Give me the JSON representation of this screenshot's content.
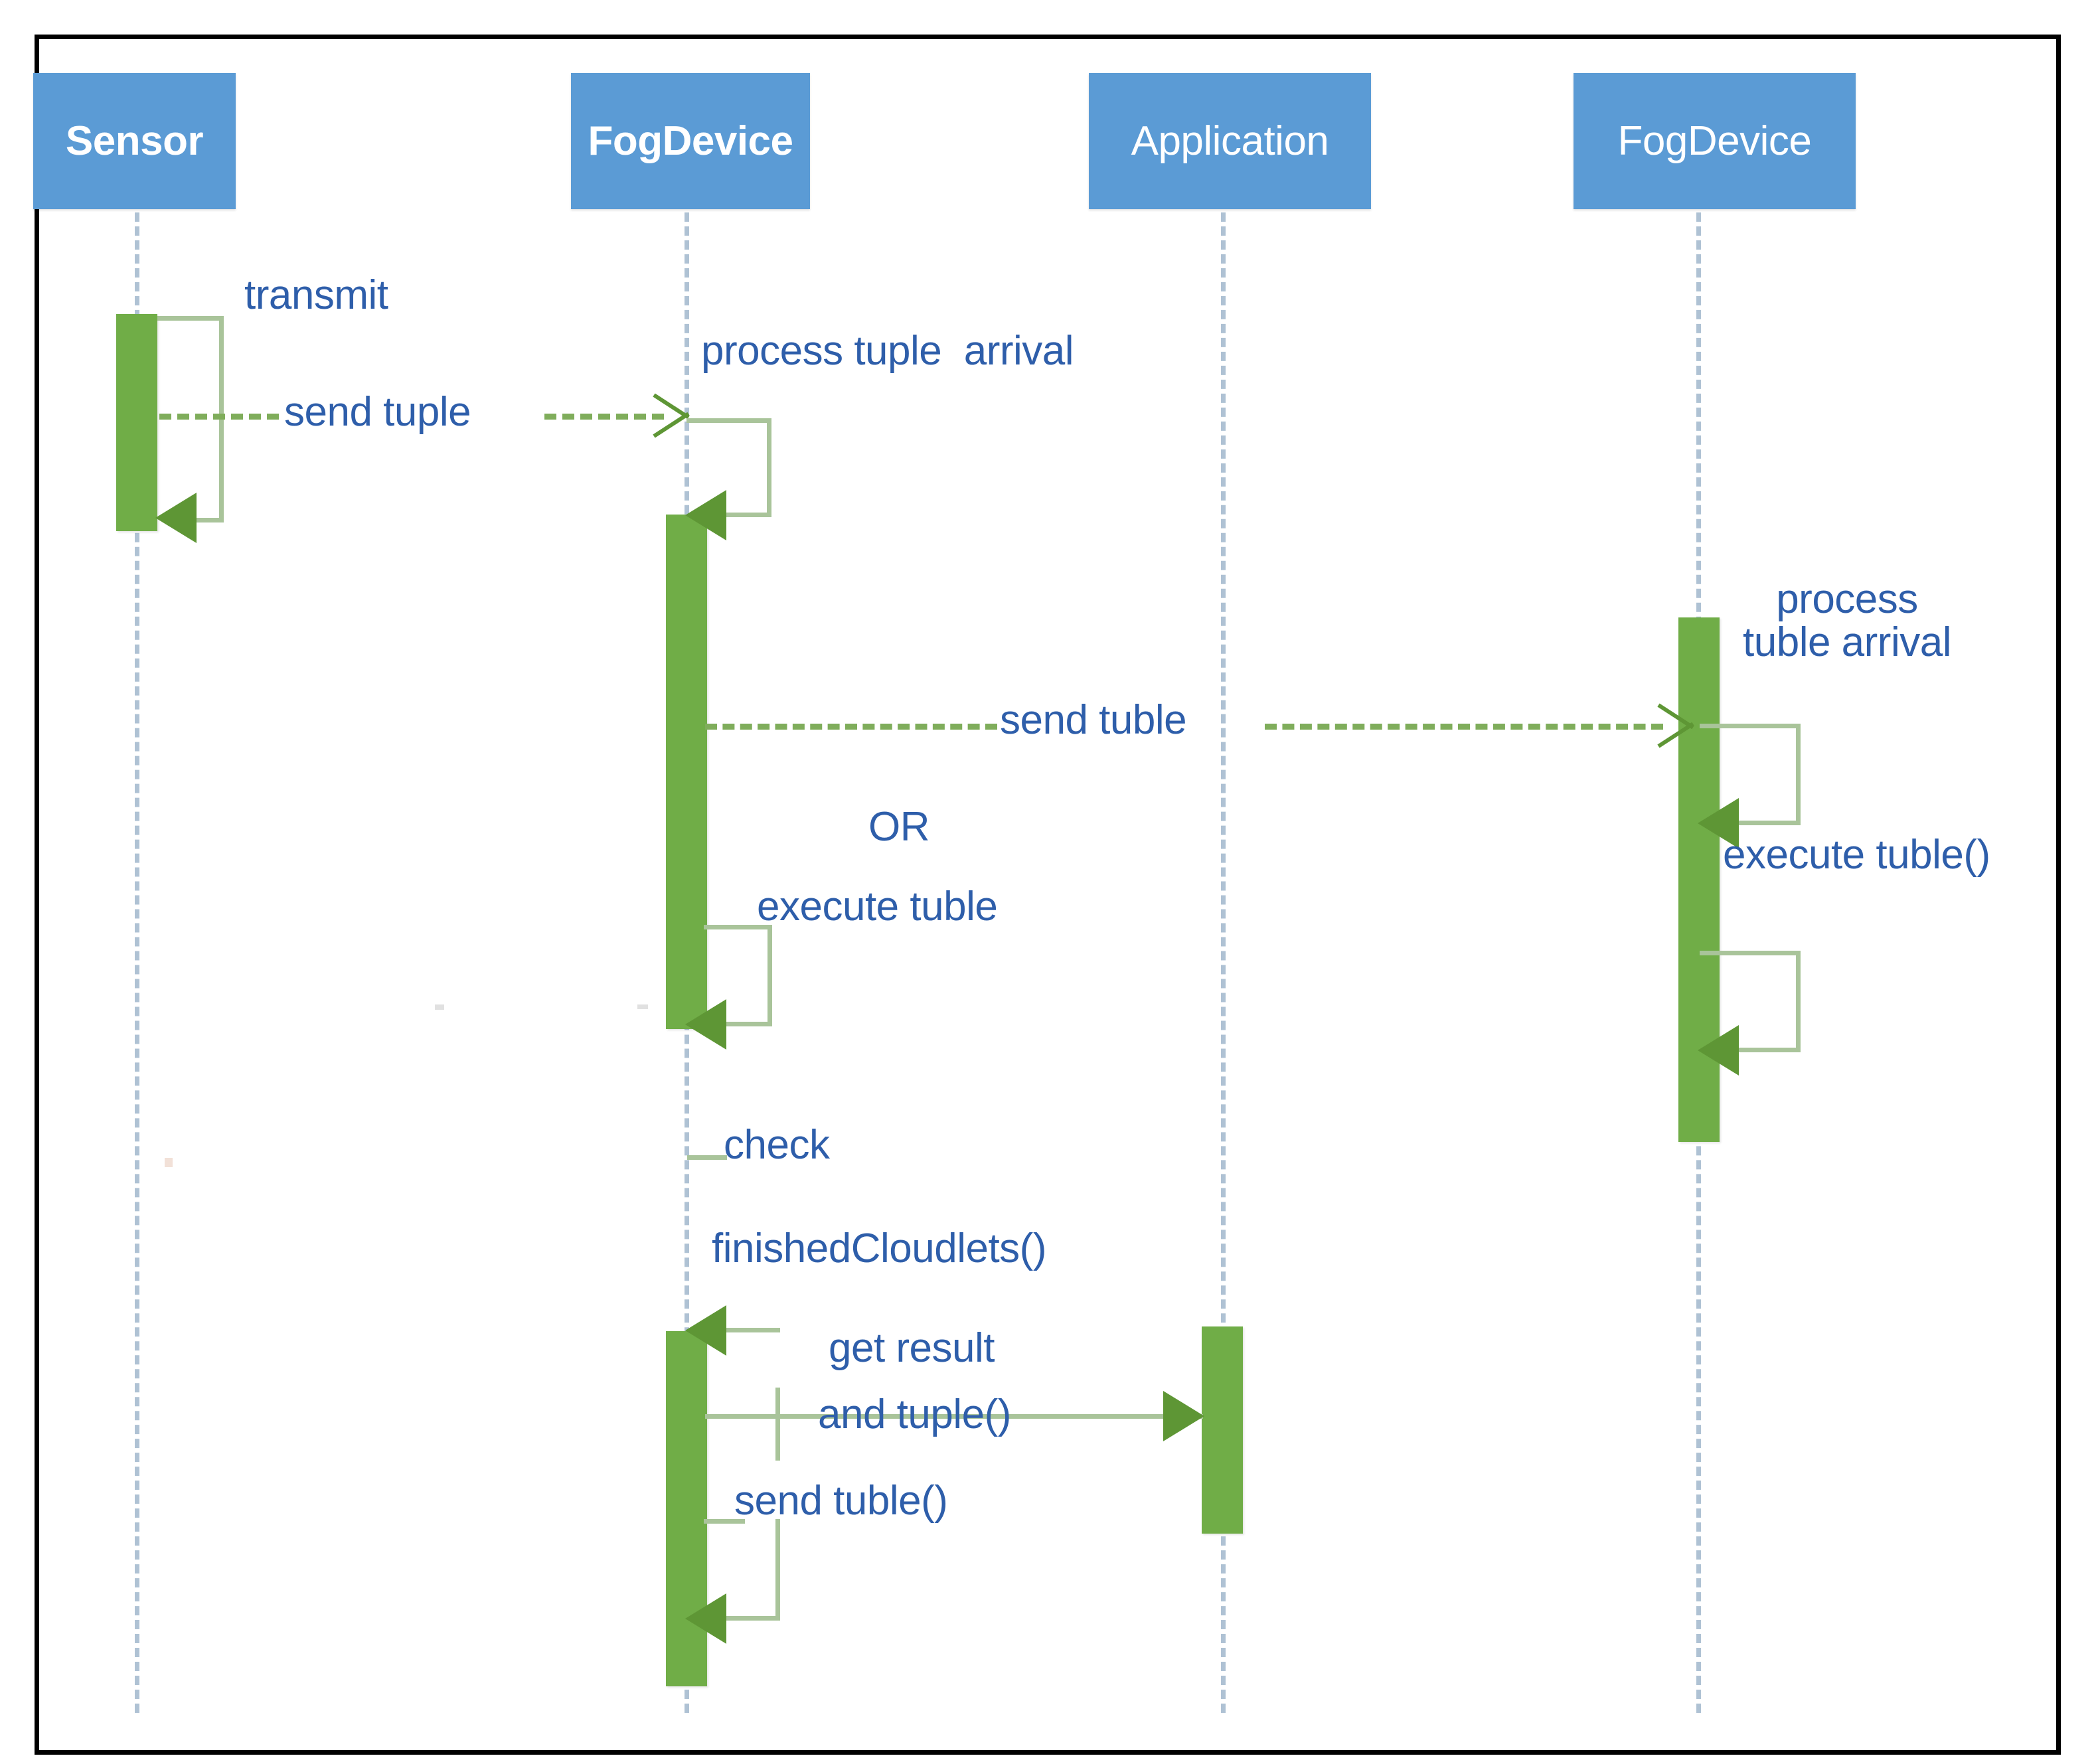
{
  "diagram": {
    "title": "Fog computing tuple processing sequence diagram",
    "type": "uml-sequence-diagram",
    "colors": {
      "lifeline_header_fill": "#5B9BD5",
      "lifeline_header_text": "#FFFFFF",
      "activation_fill": "#70AD47",
      "message_line": "#A9C49A",
      "message_dashed": "#7FAD5B",
      "arrow_head": "#5E9635",
      "label_text": "#2E5EAA",
      "lifeline_dash": "#AFC2D4",
      "frame_border": "#000000",
      "background": "#FFFFFF"
    }
  },
  "lifelines": [
    {
      "id": "sensor",
      "label": "Sensor",
      "bold": true
    },
    {
      "id": "fogdevice1",
      "label": "FogDevice",
      "bold": true
    },
    {
      "id": "application",
      "label": "Application",
      "bold": false
    },
    {
      "id": "fogdevice2",
      "label": "FogDevice",
      "bold": false
    }
  ],
  "messages": [
    {
      "id": "m1",
      "label": "transmit",
      "from": "sensor",
      "to": "sensor",
      "kind": "self",
      "style": "solid"
    },
    {
      "id": "m2",
      "label": "send tuple",
      "from": "sensor",
      "to": "fogdevice1",
      "kind": "call",
      "style": "dashed"
    },
    {
      "id": "m3",
      "label": "process tuple  arrival",
      "from": "fogdevice1",
      "to": "fogdevice1",
      "kind": "self",
      "style": "solid"
    },
    {
      "id": "m4",
      "label": "send tuble",
      "from": "fogdevice1",
      "to": "fogdevice2",
      "kind": "call",
      "style": "dashed"
    },
    {
      "id": "m5",
      "label": "process\ntuble arrival",
      "from": "fogdevice2",
      "to": "fogdevice2",
      "kind": "self",
      "style": "solid"
    },
    {
      "id": "m6",
      "label": "execute tuble()",
      "from": "fogdevice2",
      "to": "fogdevice2",
      "kind": "self",
      "style": "solid"
    },
    {
      "id": "m7",
      "label": "OR",
      "from": "fogdevice1",
      "to": "fogdevice1",
      "kind": "note",
      "style": "none"
    },
    {
      "id": "m8",
      "label": "execute tuble",
      "from": "fogdevice1",
      "to": "fogdevice1",
      "kind": "self",
      "style": "solid"
    },
    {
      "id": "m9",
      "label": "check\nfinishedCloudlets()",
      "from": "fogdevice1",
      "to": "fogdevice1",
      "kind": "self",
      "style": "solid"
    },
    {
      "id": "m10",
      "label": "get result\nand tuple()",
      "from": "fogdevice1",
      "to": "application",
      "kind": "call",
      "style": "solid"
    },
    {
      "id": "m11",
      "label": "send tuble()",
      "from": "fogdevice1",
      "to": "fogdevice1",
      "kind": "self",
      "style": "solid"
    }
  ],
  "labels": {
    "transmit": "transmit",
    "send_tuple": "send tuple",
    "process_tuple_arrival": "process tuple  arrival",
    "send_tuble": "send tuble",
    "process_line1": "process",
    "process_line2": "tuble arrival",
    "execute_tuble_paren": "execute tuble()",
    "or": "OR",
    "execute_tuble": "execute tuble",
    "check": "check",
    "finished_cloudlets": "finishedCloudlets()",
    "get_result": "get result",
    "and_tuple": "and tuple()",
    "send_tuble_paren": "send tuble()"
  }
}
